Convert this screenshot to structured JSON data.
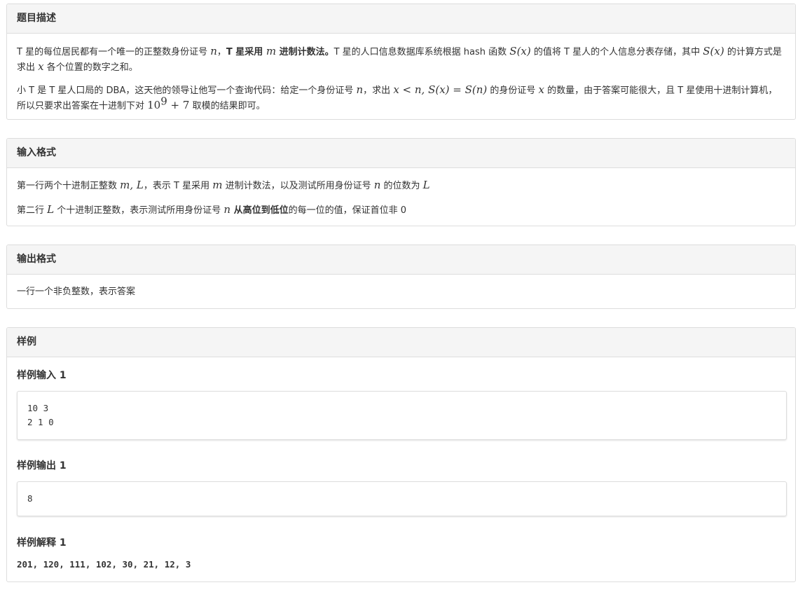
{
  "description": {
    "title": "题目描述",
    "p1": {
      "t1": "T 星的每位居民都有一个唯一的正整数身份证号 ",
      "var_n": "n",
      "t2": "，",
      "bold_a": "T 星采用 ",
      "var_m": "m",
      "bold_b": " 进制计数法。",
      "t3": "T 星的人口信息数据库系统根据 hash 函数 ",
      "Sx1": "S(x)",
      "t4": " 的值将 T 星人的个人信息分表存储，其中 ",
      "Sx2": "S(x)",
      "t5": " 的计算方式是求出 ",
      "var_x": "x",
      "t6": " 各个位置的数字之和。"
    },
    "p2": {
      "t1": "小 T 是 T 星人口局的 DBA，这天他的领导让他写一个查询代码：给定一个身份证号 ",
      "var_n": "n",
      "t2": "，求出 ",
      "cond": "x < n, S(x) = S(n)",
      "t3": " 的身份证号 ",
      "var_x": "x",
      "t4": " 的数量，由于答案可能很大，且 T 星使用十进制计算机，所以只要求出答案在十进制下对 ",
      "mod_base": "10",
      "mod_exp": "9",
      "mod_tail": " + 7",
      "t5": " 取模的结果即可。"
    }
  },
  "input_format": {
    "title": "输入格式",
    "line1": {
      "t1": "第一行两个十进制正整数 ",
      "vars": "m, L",
      "t2": "，表示 T 星采用 ",
      "var_m": "m",
      "t3": " 进制计数法，以及测试所用身份证号 ",
      "var_n": "n",
      "t4": " 的位数为 ",
      "var_L": "L"
    },
    "line2": {
      "t1": "第二行 ",
      "var_L": "L",
      "t2": " 个十进制正整数，表示测试所用身份证号 ",
      "var_n": "n",
      "bold": " 从高位到低位",
      "t3": "的每一位的值，保证首位非 0"
    }
  },
  "output_format": {
    "title": "输出格式",
    "line": "一行一个非负整数，表示答案"
  },
  "samples": {
    "title": "样例",
    "input_title": "样例输入 1",
    "input_code": "10 3\n2 1 0",
    "output_title": "样例输出 1",
    "output_code": "8",
    "explain_title": "样例解释 1",
    "explain_text": "201, 120, 111, 102, 30, 21, 12, 3"
  }
}
